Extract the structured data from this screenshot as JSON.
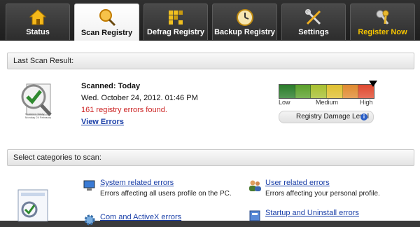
{
  "tabs": [
    {
      "label": "Status",
      "icon": "home-icon"
    },
    {
      "label": "Scan Registry",
      "icon": "magnifier-icon",
      "active": true
    },
    {
      "label": "Defrag Registry",
      "icon": "defrag-blocks-icon"
    },
    {
      "label": "Backup Registry",
      "icon": "clock-icon"
    },
    {
      "label": "Settings",
      "icon": "tools-icon"
    },
    {
      "label": "Register Now",
      "icon": "keys-icon"
    }
  ],
  "last_scan": {
    "header": "Last Scan Result:",
    "scanned_label": "Scanned: Today",
    "datetime": "Wed. October 24, 2012. 01:46 PM",
    "errors_found": "161 registry errors found.",
    "view_errors": "View Errors",
    "icon_caption": [
      "Scanned Today",
      "Monday 24 Febraury"
    ]
  },
  "damage": {
    "low": "Low",
    "medium": "Medium",
    "high": "High",
    "label": "Registry Damage Level",
    "level": 1.0,
    "colors": [
      "#2a7d2a",
      "#5aa02a",
      "#a8c030",
      "#e0c030",
      "#e08a30",
      "#e04a30"
    ]
  },
  "categories": {
    "header": "Select categories to scan:",
    "items": [
      {
        "title": "System related errors",
        "desc": "Errors affecting all users profile on the PC.",
        "icon": "computer-icon"
      },
      {
        "title": "User related errors",
        "desc": "Errors affecting your personal profile.",
        "icon": "users-icon"
      },
      {
        "title": "Com and ActiveX errors",
        "desc": "",
        "icon": "gear-icon"
      },
      {
        "title": "Startup and Uninstall errors",
        "desc": "",
        "icon": "startup-icon"
      }
    ]
  }
}
